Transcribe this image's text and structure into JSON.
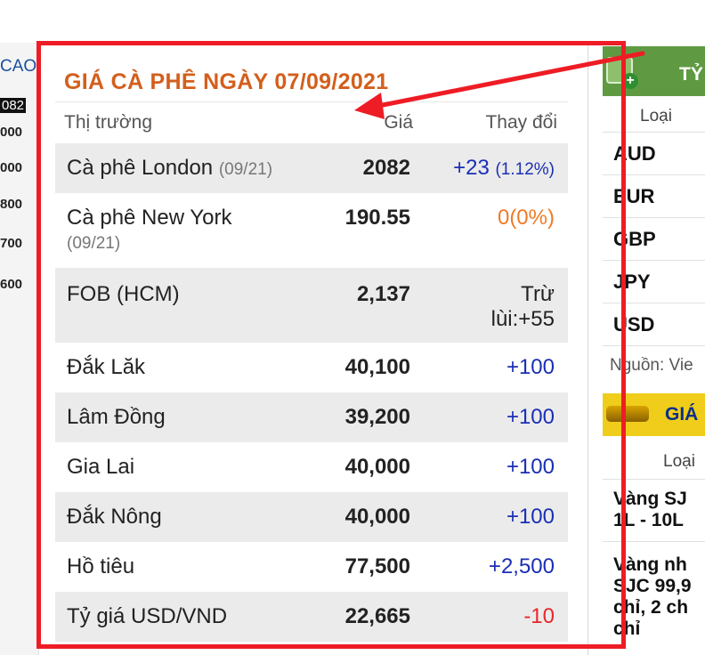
{
  "left_column": {
    "link_text": "CAO",
    "badge": "082",
    "values": [
      "000",
      "000",
      "800",
      "700",
      "600"
    ]
  },
  "coffee": {
    "title": "GIÁ CÀ PHÊ NGÀY 07/09/2021",
    "headers": {
      "market": "Thị trường",
      "price": "Giá",
      "change": "Thay đổi"
    },
    "rows": [
      {
        "name": "Cà phê London",
        "sub": "(09/21)",
        "price": "2082",
        "change": "+23",
        "pct": "(1.12%)",
        "dir": "up"
      },
      {
        "name": "Cà phê New York",
        "sub": "(09/21)",
        "price": "190.55",
        "change": "0(0%)",
        "pct": "",
        "dir": "neutral"
      },
      {
        "name": "FOB (HCM)",
        "sub": "",
        "price": "2,137",
        "change_line1": "Trừ",
        "change_line2": "lùi:+55",
        "dir": "up"
      },
      {
        "name": "Đắk Lăk",
        "sub": "",
        "price": "40,100",
        "change": "+100",
        "dir": "up"
      },
      {
        "name": "Lâm Đồng",
        "sub": "",
        "price": "39,200",
        "change": "+100",
        "dir": "up"
      },
      {
        "name": "Gia Lai",
        "sub": "",
        "price": "40,000",
        "change": "+100",
        "dir": "up"
      },
      {
        "name": "Đắk Nông",
        "sub": "",
        "price": "40,000",
        "change": "+100",
        "dir": "up"
      },
      {
        "name": "Hồ tiêu",
        "sub": "",
        "price": "77,500",
        "change": "+2,500",
        "dir": "up"
      },
      {
        "name": "Tỷ giá USD/VND",
        "sub": "",
        "price": "22,665",
        "change": "-10",
        "dir": "down"
      }
    ]
  },
  "exchange": {
    "title": "TỶ G",
    "col_type": "Loại",
    "currencies": [
      "AUD",
      "EUR",
      "GBP",
      "JPY",
      "USD"
    ],
    "source": "Nguồn: Vie"
  },
  "gold": {
    "title": "GIÁ",
    "col_type": "Loại",
    "items": [
      {
        "line1": "Vàng SJ",
        "line2": "1L - 10L"
      },
      {
        "line1": "Vàng nh",
        "line2": "SJC 99,9",
        "line3": "chỉ, 2 ch",
        "line4": "chỉ"
      }
    ]
  },
  "colors": {
    "title_orange": "#d35f1c",
    "up_blue": "#1a2fb4",
    "neutral_orange": "#f07a26",
    "down_red": "#e8262a",
    "annotation_red": "#ee1c25",
    "fx_green": "#5f9a43",
    "gold_yellow": "#f0cd1a"
  }
}
